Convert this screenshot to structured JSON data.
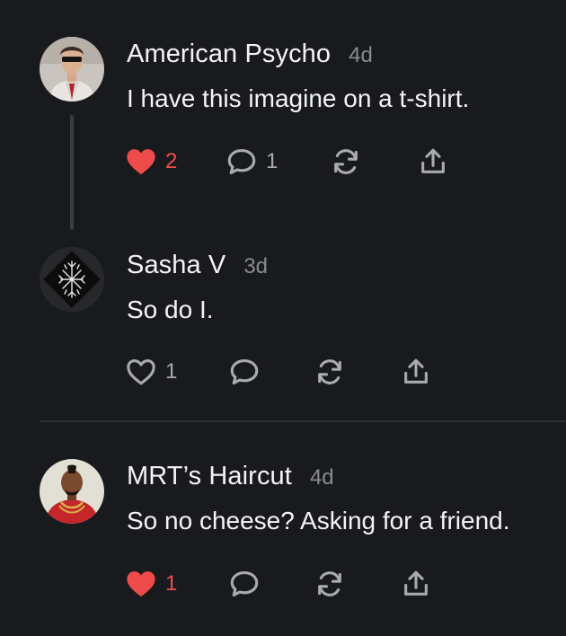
{
  "comments": [
    {
      "author": "American Psycho",
      "time": "4d",
      "text": "I have this imagine on a t-shirt.",
      "likes": "2",
      "liked": true,
      "replies": "1",
      "avatar": "man-in-suit-sunglasses-avatar"
    },
    {
      "author": "Sasha V",
      "time": "3d",
      "text": "So do I.",
      "likes": "1",
      "liked": false,
      "replies": "",
      "avatar": "geometric-rune-symbol-avatar"
    },
    {
      "author": "MRT’s Haircut",
      "time": "4d",
      "text": "So no cheese? Asking for a friend.",
      "likes": "1",
      "liked": true,
      "replies": "",
      "avatar": "man-with-mohawk-avatar"
    }
  ],
  "icons": {
    "like": "heart-icon",
    "reply": "speech-bubble-icon",
    "restack": "repost-arrows-icon",
    "share": "share-upload-icon"
  },
  "colors": {
    "background": "#181a1d",
    "liked": "#f04b4b",
    "muted": "#a9aaae",
    "text": "#f4f4f4"
  }
}
